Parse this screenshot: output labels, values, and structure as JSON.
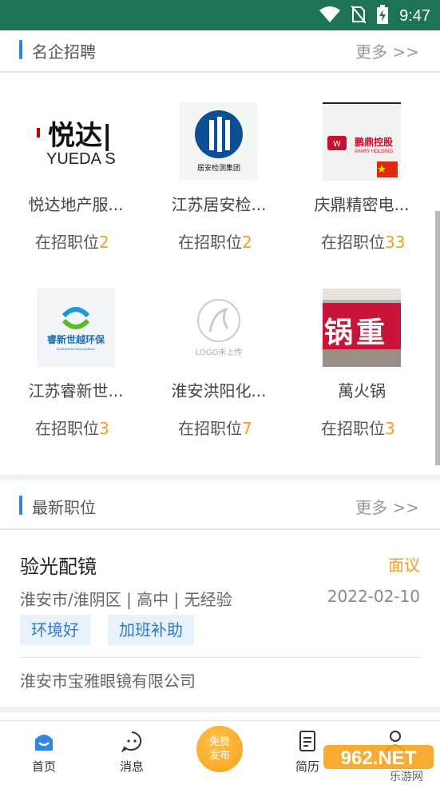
{
  "status": {
    "time": "9:47"
  },
  "famous": {
    "title": "名企招聘",
    "more": "更多 >>"
  },
  "companies": [
    {
      "name": "悦达地产服...",
      "jobs_label": "在招职位",
      "jobs": "2",
      "logo_text": "悦达",
      "logo_sub": "YUEDA S"
    },
    {
      "name": "江苏居安检...",
      "jobs_label": "在招职位",
      "jobs": "2",
      "logo_text": "居安检测集团"
    },
    {
      "name": "庆鼎精密电...",
      "jobs_label": "在招职位",
      "jobs": "33",
      "logo_text": "鹏鼎控股",
      "logo_sub": "AVARY HOLDING"
    },
    {
      "name": "江苏睿新世...",
      "jobs_label": "在招职位",
      "jobs": "3",
      "logo_text": "睿新世越环保"
    },
    {
      "name": "淮安洪阳化...",
      "jobs_label": "在招职位",
      "jobs": "7",
      "logo_text": "LOGO未上传"
    },
    {
      "name": "萬火锅",
      "jobs_label": "在招职位",
      "jobs": "3",
      "logo_text": "锅 重"
    }
  ],
  "latest": {
    "title": "最新职位",
    "more": "更多 >>"
  },
  "job": {
    "title": "验光配镜",
    "salary": "面议",
    "meta": "淮安市/淮阴区 | 高中 | 无经验",
    "date": "2022-02-10",
    "tags": [
      "环境好",
      "加班补助"
    ],
    "company": "淮安市宝雅眼镜有限公司"
  },
  "tabs": {
    "home": "首页",
    "messages": "消息",
    "publish_line1": "免费",
    "publish_line2": "发布",
    "resume": "简历"
  },
  "watermark": {
    "text": "962.NET",
    "sub": "乐游网"
  },
  "colors": {
    "status_bar": "#1e7255",
    "accent": "#2f86e6",
    "highlight": "#f0a020"
  }
}
